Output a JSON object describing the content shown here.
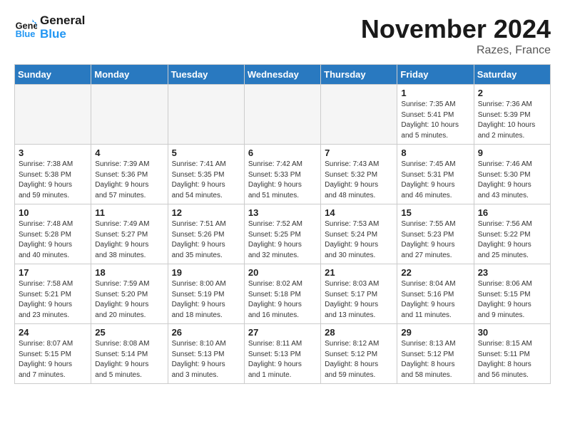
{
  "logo": {
    "line1": "General",
    "line2": "Blue"
  },
  "title": "November 2024",
  "location": "Razes, France",
  "weekdays": [
    "Sunday",
    "Monday",
    "Tuesday",
    "Wednesday",
    "Thursday",
    "Friday",
    "Saturday"
  ],
  "weeks": [
    [
      {
        "day": "",
        "detail": ""
      },
      {
        "day": "",
        "detail": ""
      },
      {
        "day": "",
        "detail": ""
      },
      {
        "day": "",
        "detail": ""
      },
      {
        "day": "",
        "detail": ""
      },
      {
        "day": "1",
        "detail": "Sunrise: 7:35 AM\nSunset: 5:41 PM\nDaylight: 10 hours\nand 5 minutes."
      },
      {
        "day": "2",
        "detail": "Sunrise: 7:36 AM\nSunset: 5:39 PM\nDaylight: 10 hours\nand 2 minutes."
      }
    ],
    [
      {
        "day": "3",
        "detail": "Sunrise: 7:38 AM\nSunset: 5:38 PM\nDaylight: 9 hours\nand 59 minutes."
      },
      {
        "day": "4",
        "detail": "Sunrise: 7:39 AM\nSunset: 5:36 PM\nDaylight: 9 hours\nand 57 minutes."
      },
      {
        "day": "5",
        "detail": "Sunrise: 7:41 AM\nSunset: 5:35 PM\nDaylight: 9 hours\nand 54 minutes."
      },
      {
        "day": "6",
        "detail": "Sunrise: 7:42 AM\nSunset: 5:33 PM\nDaylight: 9 hours\nand 51 minutes."
      },
      {
        "day": "7",
        "detail": "Sunrise: 7:43 AM\nSunset: 5:32 PM\nDaylight: 9 hours\nand 48 minutes."
      },
      {
        "day": "8",
        "detail": "Sunrise: 7:45 AM\nSunset: 5:31 PM\nDaylight: 9 hours\nand 46 minutes."
      },
      {
        "day": "9",
        "detail": "Sunrise: 7:46 AM\nSunset: 5:30 PM\nDaylight: 9 hours\nand 43 minutes."
      }
    ],
    [
      {
        "day": "10",
        "detail": "Sunrise: 7:48 AM\nSunset: 5:28 PM\nDaylight: 9 hours\nand 40 minutes."
      },
      {
        "day": "11",
        "detail": "Sunrise: 7:49 AM\nSunset: 5:27 PM\nDaylight: 9 hours\nand 38 minutes."
      },
      {
        "day": "12",
        "detail": "Sunrise: 7:51 AM\nSunset: 5:26 PM\nDaylight: 9 hours\nand 35 minutes."
      },
      {
        "day": "13",
        "detail": "Sunrise: 7:52 AM\nSunset: 5:25 PM\nDaylight: 9 hours\nand 32 minutes."
      },
      {
        "day": "14",
        "detail": "Sunrise: 7:53 AM\nSunset: 5:24 PM\nDaylight: 9 hours\nand 30 minutes."
      },
      {
        "day": "15",
        "detail": "Sunrise: 7:55 AM\nSunset: 5:23 PM\nDaylight: 9 hours\nand 27 minutes."
      },
      {
        "day": "16",
        "detail": "Sunrise: 7:56 AM\nSunset: 5:22 PM\nDaylight: 9 hours\nand 25 minutes."
      }
    ],
    [
      {
        "day": "17",
        "detail": "Sunrise: 7:58 AM\nSunset: 5:21 PM\nDaylight: 9 hours\nand 23 minutes."
      },
      {
        "day": "18",
        "detail": "Sunrise: 7:59 AM\nSunset: 5:20 PM\nDaylight: 9 hours\nand 20 minutes."
      },
      {
        "day": "19",
        "detail": "Sunrise: 8:00 AM\nSunset: 5:19 PM\nDaylight: 9 hours\nand 18 minutes."
      },
      {
        "day": "20",
        "detail": "Sunrise: 8:02 AM\nSunset: 5:18 PM\nDaylight: 9 hours\nand 16 minutes."
      },
      {
        "day": "21",
        "detail": "Sunrise: 8:03 AM\nSunset: 5:17 PM\nDaylight: 9 hours\nand 13 minutes."
      },
      {
        "day": "22",
        "detail": "Sunrise: 8:04 AM\nSunset: 5:16 PM\nDaylight: 9 hours\nand 11 minutes."
      },
      {
        "day": "23",
        "detail": "Sunrise: 8:06 AM\nSunset: 5:15 PM\nDaylight: 9 hours\nand 9 minutes."
      }
    ],
    [
      {
        "day": "24",
        "detail": "Sunrise: 8:07 AM\nSunset: 5:15 PM\nDaylight: 9 hours\nand 7 minutes."
      },
      {
        "day": "25",
        "detail": "Sunrise: 8:08 AM\nSunset: 5:14 PM\nDaylight: 9 hours\nand 5 minutes."
      },
      {
        "day": "26",
        "detail": "Sunrise: 8:10 AM\nSunset: 5:13 PM\nDaylight: 9 hours\nand 3 minutes."
      },
      {
        "day": "27",
        "detail": "Sunrise: 8:11 AM\nSunset: 5:13 PM\nDaylight: 9 hours\nand 1 minute."
      },
      {
        "day": "28",
        "detail": "Sunrise: 8:12 AM\nSunset: 5:12 PM\nDaylight: 8 hours\nand 59 minutes."
      },
      {
        "day": "29",
        "detail": "Sunrise: 8:13 AM\nSunset: 5:12 PM\nDaylight: 8 hours\nand 58 minutes."
      },
      {
        "day": "30",
        "detail": "Sunrise: 8:15 AM\nSunset: 5:11 PM\nDaylight: 8 hours\nand 56 minutes."
      }
    ]
  ]
}
